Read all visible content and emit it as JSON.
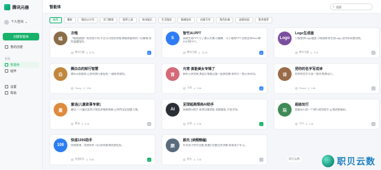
{
  "app": {
    "title": "腾讯元器"
  },
  "user": {
    "name": "个人空间"
  },
  "sidebar": {
    "new_chat": "创建智能体",
    "items": [
      {
        "label": "我的创建"
      },
      {
        "label": "发现"
      },
      {
        "label": "智能体"
      },
      {
        "label": "插件"
      },
      {
        "label": "设置"
      },
      {
        "label": "帮助"
      }
    ],
    "section": "发现"
  },
  "header": {
    "title": "智能体"
  },
  "search": {
    "placeholder": "搜索"
  },
  "tabs": [
    {
      "label": "推荐"
    },
    {
      "label": "最新"
    },
    {
      "label": "微信公众号"
    },
    {
      "label": "学习教育"
    },
    {
      "label": "效率工具"
    },
    {
      "label": "休闲娱乐"
    },
    {
      "label": "生活服务"
    },
    {
      "label": "情感陪伴"
    },
    {
      "label": "创意写作"
    },
    {
      "label": "角色扮演"
    },
    {
      "label": "创意绘画"
    },
    {
      "label": "更多推荐"
    }
  ],
  "cards": [
    {
      "name": "次喵",
      "desc": "《喵哥歌曲》再也找不到,不过可以找到次喵,做猫咪喜欢的一切事情,给你温暖陪伴。",
      "author": "腾讯元器",
      "count": "8.7k",
      "badge": "blue",
      "color": "#8b6d4a",
      "glyph": "喵"
    },
    {
      "name": "智竹AI-PPT",
      "desc": "高效生成PPT,写了演示文稿,可编辑、可下载的PPT,目前支持Word和PDF转PPT。",
      "author": "腾讯元器",
      "count": "10.2k",
      "badge": "blue",
      "color": "#2f7cf6",
      "glyph": "S"
    },
    {
      "name": "Logo生成器",
      "desc": "只需提供Logo描述,小助理帮你生成Logo,支持多风格切换。",
      "author": "腾讯元器",
      "count": "3.1k",
      "badge": "gray",
      "color": "#7a4d9e",
      "glyph": "Logo"
    },
    {
      "name": "腾白白的鲜行智慧",
      "desc": "腾讯AI智能体,让你的旅行更轻松,一键帮你规划。",
      "author": "Fancy",
      "count": "2.5k",
      "badge": "none",
      "color": "#c2873e",
      "glyph": "白"
    },
    {
      "name": "元宵·高能美女专辑了",
      "desc": "新年元宵到来,美女们穿越汉服一起来欢聚,帮你写一首元宵诗词。",
      "author": "元宵",
      "count": "2.6k",
      "badge": "blue",
      "color": "#d46a78",
      "glyph": "宵"
    },
    {
      "name": "把你的名字写成诗",
      "desc": "把你的名字写成一首诗,唯美动人。",
      "author": "Peace",
      "count": "1.8k",
      "badge": "gray",
      "color": "#9a6b48",
      "glyph": "诗"
    },
    {
      "name": "童话(儿童故事专家)",
      "desc": "童话,一只童话里的小狗会讲睡前故事,让你的宝宝甜甜入睡。",
      "author": "童话",
      "count": "4.1k",
      "badge": "gray",
      "color": "#e08a3c",
      "glyph": "童"
    },
    {
      "name": "足球超高情商AI助手",
      "desc": "高情商AI助手,帮你回复朋友,化解尴尬,不怕冷场。",
      "author": "足球",
      "count": "3.3k",
      "badge": "green",
      "color": "#2a2f36",
      "glyph": "AI"
    },
    {
      "name": "超级玩行",
      "desc": "超级玩行是一个旅行规划助手,让旅途更精彩。",
      "author": "元行",
      "count": "1.2k",
      "badge": "gray",
      "color": "#3f8a55",
      "glyph": "玩"
    },
    {
      "name": "快递1006助手",
      "desc": "快递查询、快递寄件,可以帮你查询快递信息。",
      "author": "快递助手",
      "count": "5.6k",
      "badge": "green",
      "color": "#2d7ef0",
      "glyph": "100"
    },
    {
      "name": "颜氏 (读题精编)",
      "desc": "针对孩子的作业题,快速识别题目并讲解,帮助孩子学习。",
      "author": "颜氏",
      "count": "2.0k",
      "badge": "gray",
      "color": "#5a6b7d",
      "glyph": "颜"
    },
    {
      "name": "",
      "desc": "",
      "author": "",
      "count": "",
      "badge": "none",
      "color": "#ffffff",
      "glyph": ""
    }
  ],
  "watermark": {
    "text": "职贝云数",
    "chip": "职贝云数"
  }
}
